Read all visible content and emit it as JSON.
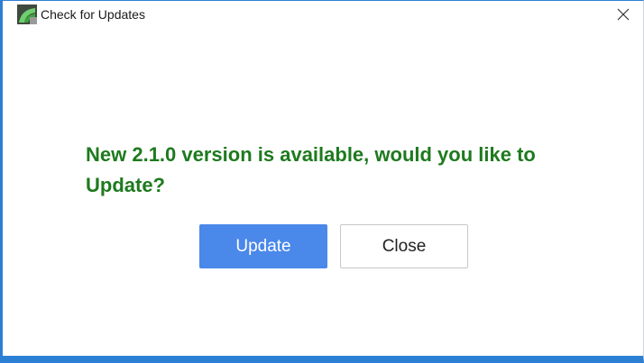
{
  "window": {
    "title": "Check for Updates",
    "close_icon": "close-icon",
    "app_icon": "app-logo-icon"
  },
  "dialog": {
    "message_line1": "New 2.1.0 version is available, would you like to",
    "message_line2": "Update?",
    "update_label": "Update",
    "close_label": "Close"
  },
  "colors": {
    "accent_border": "#2b7fd4",
    "message_text": "#1e7a1e",
    "primary_button": "#4a88ea"
  }
}
